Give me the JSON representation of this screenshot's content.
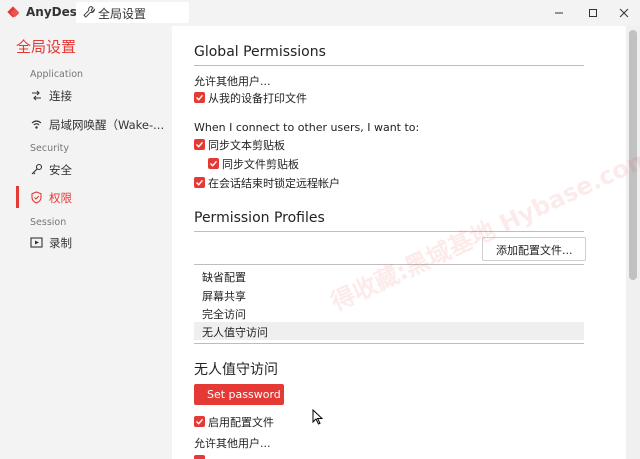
{
  "titlebar": {
    "app_name": "AnyDesk",
    "tab_label": "全局设置",
    "icons": [
      "anydesk-logo",
      "wrench-icon",
      "minimize-icon",
      "maximize-icon",
      "close-icon"
    ]
  },
  "sidebar": {
    "title": "全局设置",
    "sections": {
      "application": "Application",
      "security": "Security",
      "session": "Session"
    },
    "items": [
      {
        "label": "连接",
        "icon": "connection-icon"
      },
      {
        "label": "局域网唤醒（Wake-...",
        "icon": "wake-on-lan-icon"
      },
      {
        "label": "安全",
        "icon": "key-icon"
      },
      {
        "label": "权限",
        "icon": "shield-icon",
        "active": true
      },
      {
        "label": "录制",
        "icon": "record-icon"
      }
    ]
  },
  "main": {
    "global_permissions": {
      "heading": "Global Permissions",
      "allow_others": "允许其他用户...",
      "print_files": "从我的设备打印文件",
      "connect_to_others": "When I connect to other users, I want to:",
      "sync_clipboard_text": "同步文本剪贴板",
      "sync_clipboard_files": "同步文件剪贴板",
      "lock_remote_account": "在会话结束时锁定远程帐户"
    },
    "permission_profiles": {
      "heading": "Permission Profiles",
      "add_button": "添加配置文件...",
      "profiles": [
        "缺省配置",
        "屏幕共享",
        "完全访问",
        "无人值守访问"
      ],
      "selected_index": 3
    },
    "unattended": {
      "heading": "无人值守访问",
      "set_password": "Set password",
      "enable_profile": "启用配置文件",
      "allow_others": "允许其他用户..."
    }
  },
  "watermark": "得收藏:黑域基地 Hybase.com",
  "colors": {
    "accent": "#e53935",
    "sidebar_bg": "#f3f3f3",
    "content_bg": "#ffffff",
    "selected_row": "#efefef"
  }
}
